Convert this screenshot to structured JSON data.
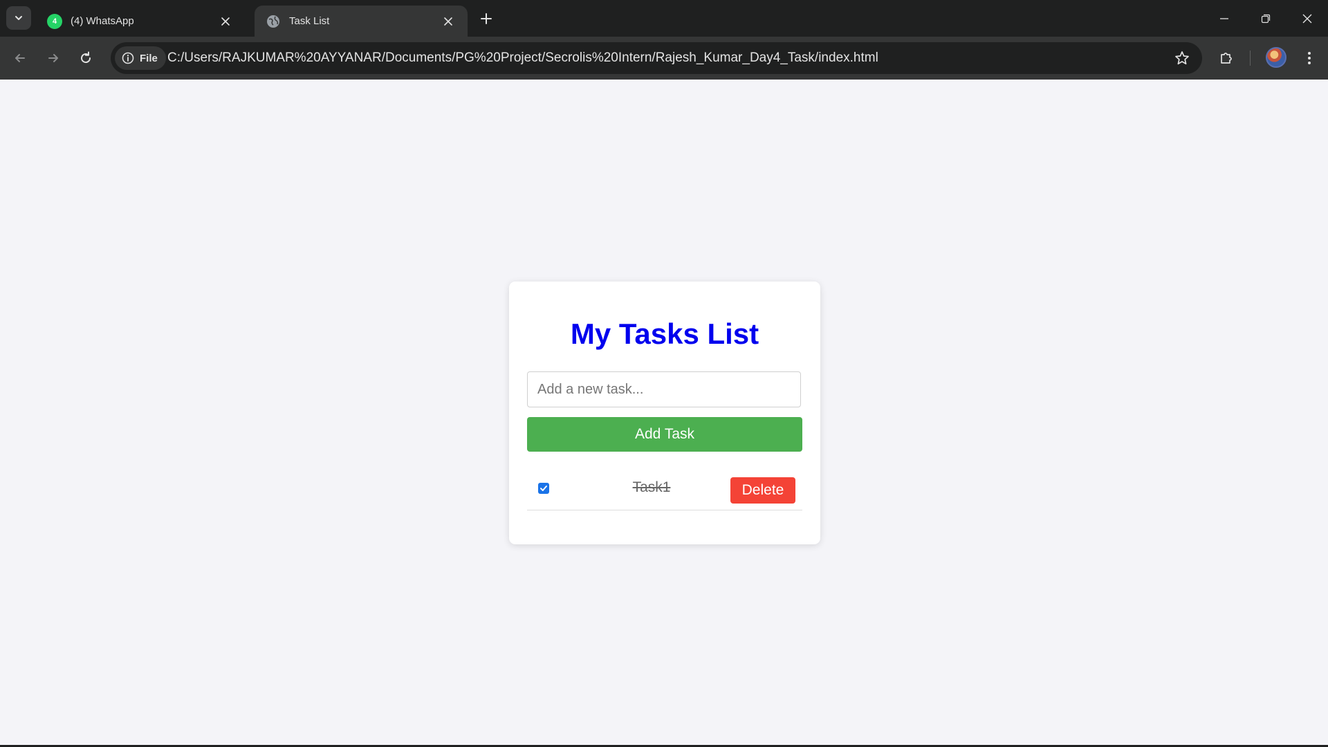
{
  "browser": {
    "tabs": [
      {
        "title": "(4) WhatsApp",
        "icon": "whatsapp-icon",
        "active": false
      },
      {
        "title": "Task List",
        "icon": "globe-icon",
        "active": true
      }
    ],
    "site_chip_label": "File",
    "url": "C:/Users/RAJKUMAR%20AYYANAR/Documents/PG%20Project/Secrolis%20Intern/Rajesh_Kumar_Day4_Task/index.html",
    "whatsapp_badge": "4"
  },
  "app": {
    "title": "My Tasks List",
    "input_placeholder": "Add a new task...",
    "input_value": "",
    "add_button_label": "Add Task",
    "tasks": [
      {
        "text": "Task1",
        "completed": true,
        "delete_label": "Delete"
      }
    ]
  },
  "colors": {
    "title": "#0000ee",
    "add_button": "#4caf50",
    "delete_button": "#f44336",
    "page_background": "#f4f4f8",
    "chrome_dark": "#1f2020",
    "chrome_toolbar": "#353636"
  }
}
